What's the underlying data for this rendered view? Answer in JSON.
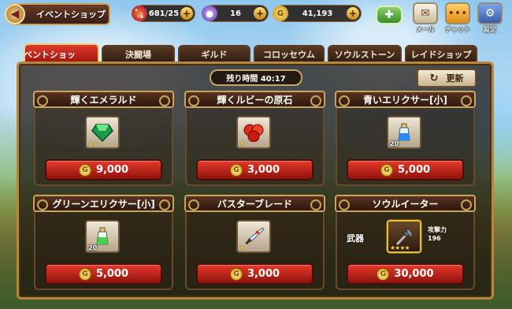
{
  "header": {
    "back_label": "イベントショップ",
    "stamina": "681/25",
    "orbs": "16",
    "gold": "41,193",
    "plus": "+",
    "mail_label": "メール",
    "chat_label": "チャット",
    "settings_label": "設定"
  },
  "tabs": [
    {
      "label": "ベントショッ",
      "active": true
    },
    {
      "label": "決闘場",
      "active": false
    },
    {
      "label": "ギルド",
      "active": false
    },
    {
      "label": "コロッセウム",
      "active": false
    },
    {
      "label": "ソウルストーン",
      "active": false
    },
    {
      "label": "レイドショップ",
      "active": false
    }
  ],
  "panel": {
    "timer": "残り時間 40:17",
    "refresh_label": "更新"
  },
  "items": [
    {
      "name": "輝くエメラルド",
      "price": "9,000",
      "stars": "★★",
      "qty": "",
      "icon": "emerald-icon"
    },
    {
      "name": "輝くルビーの原石",
      "price": "3,000",
      "stars": "★",
      "qty": "",
      "icon": "ruby-icon"
    },
    {
      "name": "青いエリクサー[小]",
      "price": "5,000",
      "stars": "",
      "qty": "20",
      "icon": "blue-elixir-icon"
    },
    {
      "name": "グリーンエリクサー[小]",
      "price": "5,000",
      "stars": "",
      "qty": "20",
      "icon": "green-elixir-icon"
    },
    {
      "name": "バスターブレード",
      "price": "3,000",
      "stars": "★",
      "qty": "",
      "icon": "buster-blade-icon"
    },
    {
      "name": "ソウルイーター",
      "price": "30,000",
      "stars": "★★★★",
      "qty": "",
      "icon": "soul-eater-icon",
      "weapon_tag": "武器",
      "attack_label": "攻撃力",
      "attack_value": "196"
    }
  ],
  "colors": {
    "accent_red": "#c8201a",
    "frame_gold": "#c9a45c",
    "coin_gold": "#d19a12"
  }
}
